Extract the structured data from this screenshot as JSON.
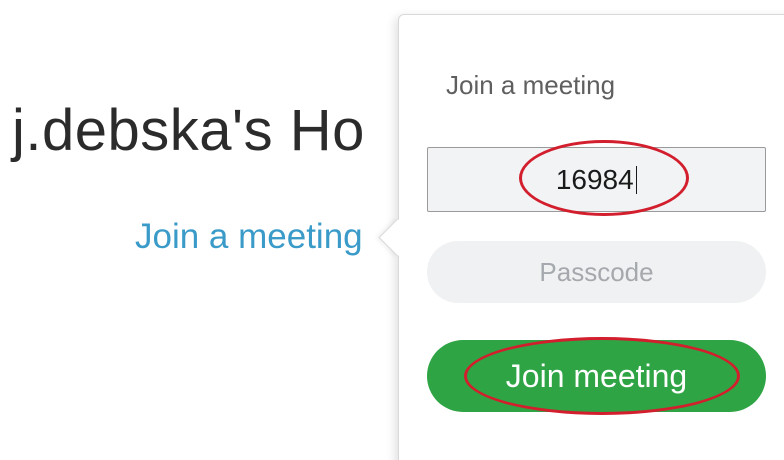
{
  "room": {
    "title": "j.debska's Ho"
  },
  "link": {
    "join_label": "Join a meeting"
  },
  "popover": {
    "heading": "Join a meeting",
    "meeting_number_value": "16984",
    "passcode_placeholder": "Passcode",
    "join_button_label": "Join meeting"
  },
  "colors": {
    "link_blue": "#3a9bc9",
    "button_green": "#2ea444",
    "annotation_red": "#d21e2d"
  }
}
